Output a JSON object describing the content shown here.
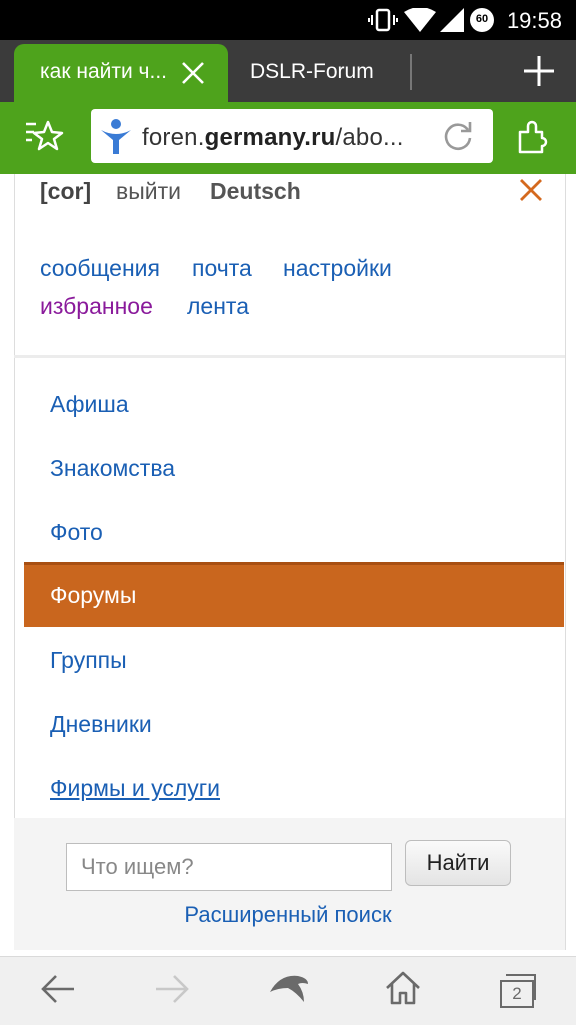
{
  "status_bar": {
    "time": "19:58",
    "battery_level": "60",
    "icons": [
      "vibrate-icon",
      "wifi-icon",
      "signal-icon",
      "battery-icon"
    ]
  },
  "tabs": [
    {
      "label": "как найти ч...",
      "active": true
    },
    {
      "label": "DSLR-Forum",
      "active": false
    }
  ],
  "address_bar": {
    "url_prefix": "foren.",
    "url_domain": "germany.ru",
    "url_suffix": "/abo..."
  },
  "header": {
    "username": "[cor]",
    "logout": "выйти",
    "language": "Deutsch"
  },
  "user_links": {
    "messages": "сообщения",
    "mail": "почта",
    "settings": "настройки",
    "favorites": "избранное",
    "feed": "лента"
  },
  "menu": {
    "items": [
      {
        "label": "Афиша"
      },
      {
        "label": "Знакомства"
      },
      {
        "label": "Фото"
      },
      {
        "label": "Форумы",
        "active": true
      },
      {
        "label": "Группы"
      },
      {
        "label": "Дневники"
      },
      {
        "label": "Фирмы и услуги"
      }
    ]
  },
  "search": {
    "placeholder": "Что ищем?",
    "button": "Найти",
    "advanced": "Расширенный поиск"
  },
  "bottom_nav": {
    "tab_count": "2"
  },
  "colors": {
    "browser_green": "#4ea31c",
    "active_menu": "#c9661e",
    "link_blue": "#1a5fb4",
    "visited_purple": "#8a1a9b",
    "close_orange": "#d4691e"
  }
}
